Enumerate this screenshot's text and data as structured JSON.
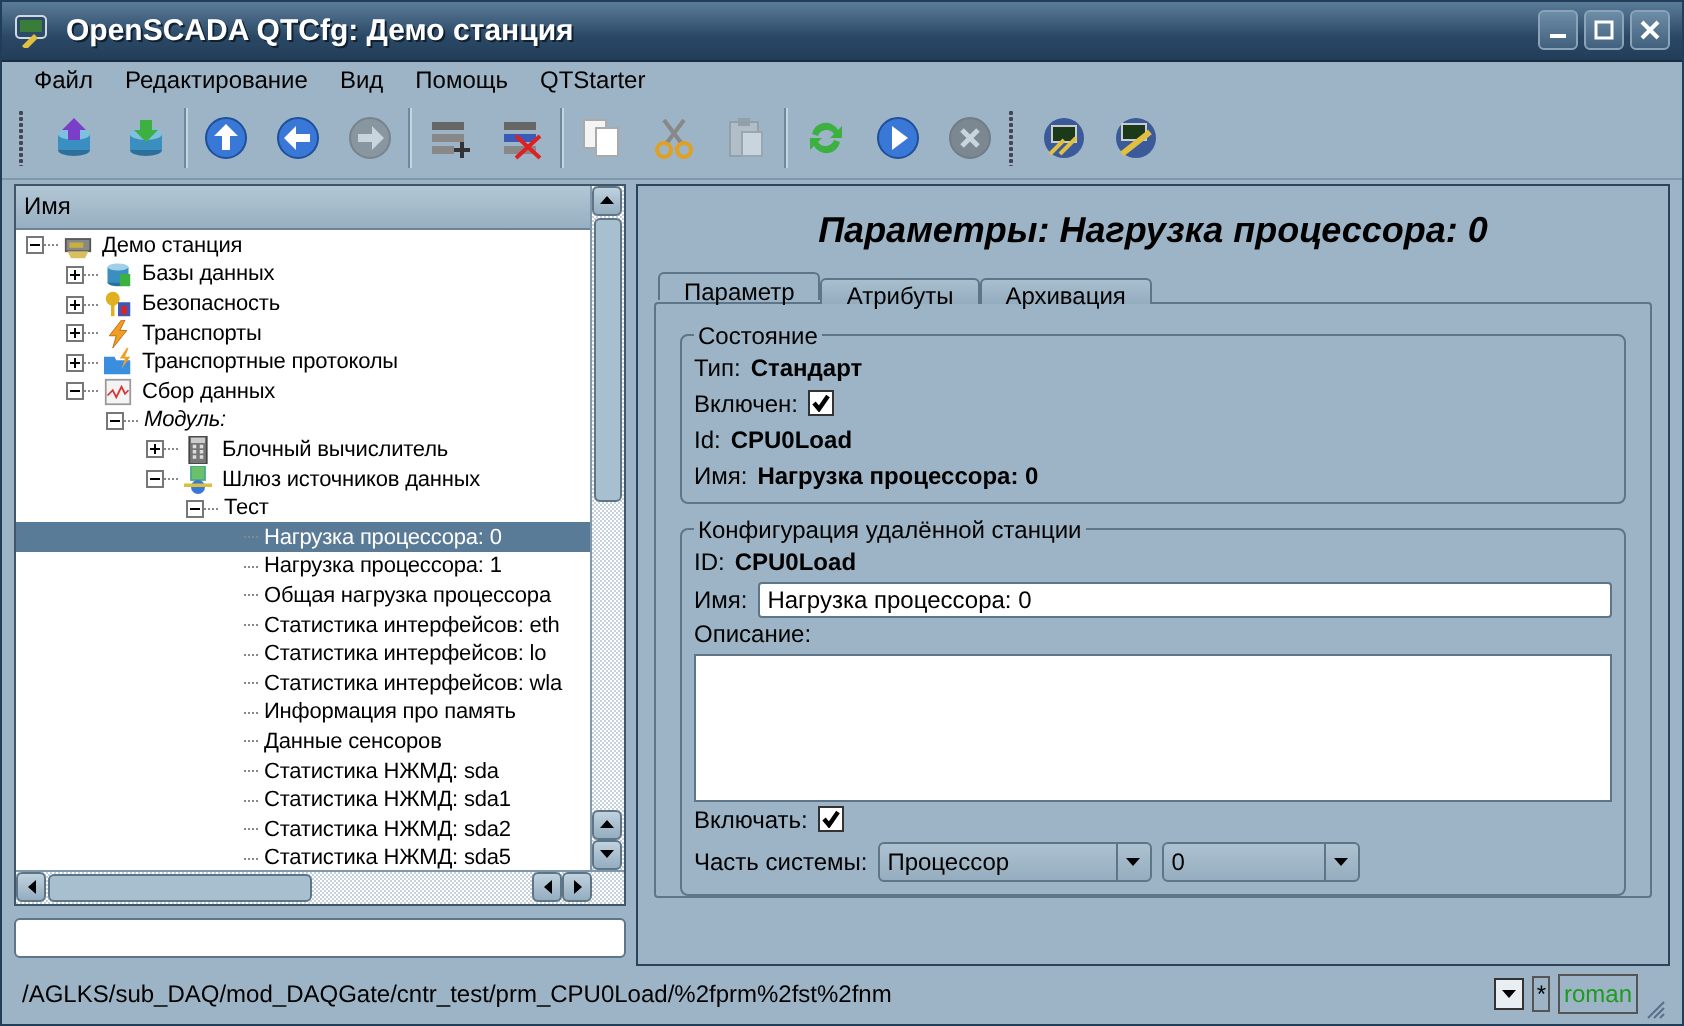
{
  "window": {
    "title": "OpenSCADA QTCfg: Демо станция"
  },
  "menu": [
    {
      "label": "Файл"
    },
    {
      "label": "Редактирование"
    },
    {
      "label": "Вид"
    },
    {
      "label": "Помощь"
    },
    {
      "label": "QTStarter"
    }
  ],
  "toolbar": [
    [
      {
        "disabled": false
      },
      {
        "disabled": false
      }
    ],
    [
      {
        "disabled": false
      },
      {
        "disabled": false
      },
      {
        "disabled": true
      }
    ],
    [
      {
        "disabled": false
      },
      {
        "disabled": false
      }
    ],
    [
      {
        "disabled": false
      },
      {
        "disabled": false
      },
      {
        "disabled": true
      }
    ],
    [
      {
        "disabled": false
      },
      {
        "disabled": false
      },
      {
        "disabled": true
      }
    ],
    [
      {
        "disabled": false
      },
      {
        "disabled": false
      }
    ]
  ],
  "tree": {
    "header": "Имя",
    "nodes": [
      {
        "label": "Демо станция",
        "kind": "object",
        "expanded": true,
        "selected": false,
        "children": [
          {
            "label": "Базы данных",
            "kind": "object",
            "expanded": false,
            "selected": false
          },
          {
            "label": "Безопасность",
            "kind": "object",
            "expanded": false,
            "selected": false
          },
          {
            "label": "Транспорты",
            "kind": "object",
            "expanded": false,
            "selected": false
          },
          {
            "label": "Транспортные протоколы",
            "kind": "object",
            "expanded": false,
            "selected": false
          },
          {
            "label": "Сбор данных",
            "kind": "object",
            "expanded": true,
            "selected": false,
            "children": [
              {
                "label": "Модуль:",
                "kind": "group",
                "expanded": true,
                "selected": false,
                "children": [
                  {
                    "label": "Блочный вычислитель",
                    "kind": "object",
                    "expanded": false,
                    "selected": false
                  },
                  {
                    "label": "Шлюз источников данных",
                    "kind": "object",
                    "expanded": true,
                    "selected": false,
                    "children": [
                      {
                        "label": "Тест",
                        "kind": "item",
                        "expanded": true,
                        "selected": false,
                        "children": [
                          {
                            "label": "Нагрузка процессора: 0",
                            "kind": "item",
                            "selected": true
                          },
                          {
                            "label": "Нагрузка процессора: 1",
                            "kind": "item",
                            "selected": false
                          },
                          {
                            "label": "Общая нагрузка процессора",
                            "kind": "item",
                            "selected": false
                          },
                          {
                            "label": "Статистика интерфейсов: eth",
                            "kind": "item",
                            "selected": false
                          },
                          {
                            "label": "Статистика интерфейсов: lo",
                            "kind": "item",
                            "selected": false
                          },
                          {
                            "label": "Статистика интерфейсов: wla",
                            "kind": "item",
                            "selected": false
                          },
                          {
                            "label": "Информация про память",
                            "kind": "item",
                            "selected": false
                          },
                          {
                            "label": "Данные сенсоров",
                            "kind": "item",
                            "selected": false
                          },
                          {
                            "label": "Статистика НЖМД: sda",
                            "kind": "item",
                            "selected": false
                          },
                          {
                            "label": "Статистика НЖМД: sda1",
                            "kind": "item",
                            "selected": false
                          },
                          {
                            "label": "Статистика НЖМД: sda2",
                            "kind": "item",
                            "selected": false
                          },
                          {
                            "label": "Статистика НЖМД: sda5",
                            "kind": "item",
                            "selected": false
                          }
                        ]
                      }
                    ]
                  }
                ]
              }
            ]
          }
        ]
      }
    ]
  },
  "panel": {
    "title": "Параметры: Нагрузка процессора: 0",
    "tabs": [
      {
        "label": "Параметр",
        "selected": true
      },
      {
        "label": "Атрибуты",
        "selected": false
      },
      {
        "label": "Архивация",
        "selected": false
      }
    ],
    "groups": [
      {
        "title": "Состояние",
        "fields": [
          {
            "kind": "text",
            "label": "Тип:",
            "value": "Стандарт"
          },
          {
            "kind": "checkbox",
            "label": "Включен:",
            "checked": true
          },
          {
            "kind": "text",
            "label": "Id:",
            "value": "CPU0Load"
          },
          {
            "kind": "text",
            "label": "Имя:",
            "value": "Нагрузка процессора: 0"
          }
        ]
      },
      {
        "title": "Конфигурация удалённой станции",
        "fields": [
          {
            "kind": "text",
            "label": "ID:",
            "value": "CPU0Load"
          },
          {
            "kind": "input",
            "label": "Имя:",
            "value": "Нагрузка процессора: 0"
          },
          {
            "kind": "textarea",
            "label": "Описание:"
          },
          {
            "kind": "checkbox",
            "label": "Включать:",
            "checked": true
          },
          {
            "kind": "combos",
            "label": "Часть системы:",
            "values": [
              "Процессор",
              "0"
            ]
          }
        ]
      }
    ]
  },
  "status_bar": {
    "path": "/AGLKS/sub_DAQ/mod_DAQGate/cntr_test/prm_CPU0Load/%2fprm%2fst%2fnm",
    "modified": "*",
    "user": "roman"
  }
}
